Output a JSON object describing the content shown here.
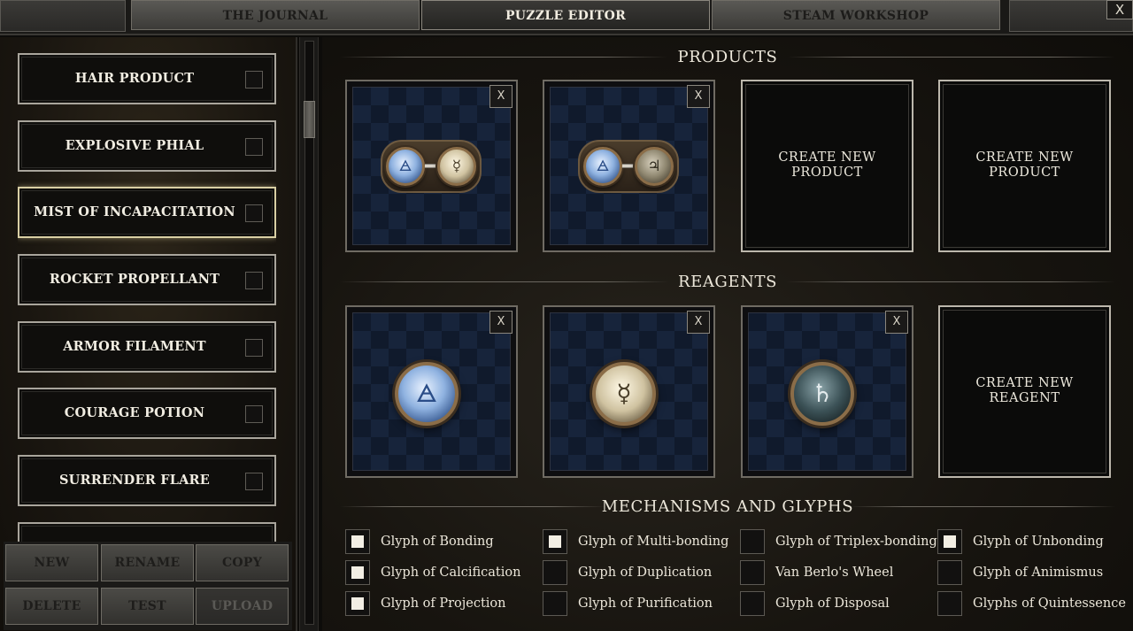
{
  "tabs": [
    {
      "label": "THE JOURNAL",
      "active": false
    },
    {
      "label": "PUZZLE EDITOR",
      "active": true
    },
    {
      "label": "STEAM WORKSHOP",
      "active": false
    }
  ],
  "close_label": "X",
  "puzzles": [
    {
      "label": "HAIR PRODUCT",
      "selected": false
    },
    {
      "label": "EXPLOSIVE PHIAL",
      "selected": false
    },
    {
      "label": "MIST OF INCAPACITATION",
      "selected": true
    },
    {
      "label": "ROCKET PROPELLANT",
      "selected": false
    },
    {
      "label": "ARMOR FILAMENT",
      "selected": false
    },
    {
      "label": "COURAGE POTION",
      "selected": false
    },
    {
      "label": "SURRENDER FLARE",
      "selected": false
    }
  ],
  "buttons": {
    "new": "NEW",
    "rename": "RENAME",
    "copy": "COPY",
    "delete": "DELETE",
    "test": "TEST",
    "upload": "UPLOAD"
  },
  "products": {
    "title": "PRODUCTS",
    "items": [
      {
        "atoms": [
          {
            "element": "air",
            "symbol": "🜁"
          },
          {
            "element": "quicksilver",
            "symbol": "☿"
          }
        ],
        "remove_label": "X"
      },
      {
        "atoms": [
          {
            "element": "air",
            "symbol": "🜁"
          },
          {
            "element": "tin",
            "symbol": "♃"
          }
        ],
        "remove_label": "X"
      }
    ],
    "create_label": "CREATE NEW PRODUCT"
  },
  "reagents": {
    "title": "REAGENTS",
    "items": [
      {
        "element": "air",
        "symbol": "🜁",
        "remove_label": "X"
      },
      {
        "element": "quicksilver",
        "symbol": "☿",
        "remove_label": "X"
      },
      {
        "element": "lead",
        "symbol": "♄",
        "remove_label": "X"
      }
    ],
    "create_label": "CREATE NEW REAGENT"
  },
  "mechanisms": {
    "title": "MECHANISMS AND GLYPHS",
    "items": [
      {
        "label": "Glyph of Bonding",
        "checked": true
      },
      {
        "label": "Glyph of Multi-bonding",
        "checked": true
      },
      {
        "label": "Glyph of Triplex-bonding",
        "checked": false
      },
      {
        "label": "Glyph of Unbonding",
        "checked": true
      },
      {
        "label": "Glyph of Calcification",
        "checked": true
      },
      {
        "label": "Glyph of Duplication",
        "checked": false
      },
      {
        "label": "Van Berlo's Wheel",
        "checked": false
      },
      {
        "label": "Glyph of Animismus",
        "checked": false
      },
      {
        "label": "Glyph of Projection",
        "checked": true
      },
      {
        "label": "Glyph of Purification",
        "checked": false
      },
      {
        "label": "Glyph of Disposal",
        "checked": false
      },
      {
        "label": "Glyphs of Quintessence",
        "checked": false
      }
    ]
  }
}
